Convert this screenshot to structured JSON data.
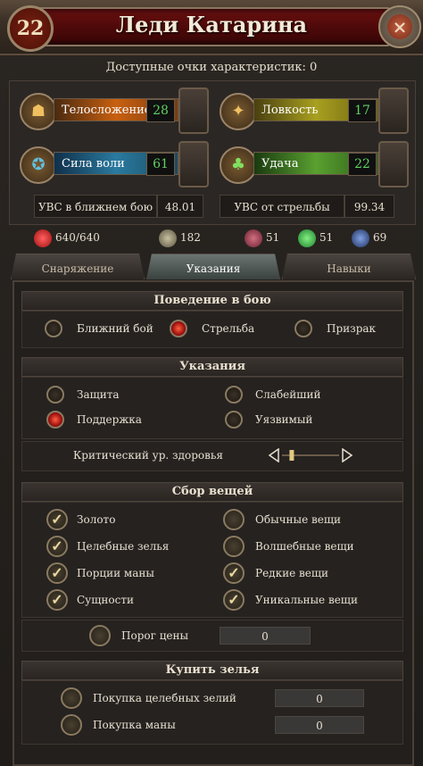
{
  "header": {
    "title": "Леди Катарина",
    "level": "22",
    "close_icon": "close-icon"
  },
  "points_label": "Доступные очки характеристик: 0",
  "attributes": [
    {
      "name": "Телосложение",
      "value": "28",
      "icon": "constitution-icon",
      "color": "#c86010"
    },
    {
      "name": "Ловкость",
      "value": "17",
      "icon": "dexterity-icon",
      "color": "#a8a020"
    },
    {
      "name": "Сила воли",
      "value": "61",
      "icon": "willpower-icon",
      "color": "#2a7aa0"
    },
    {
      "name": "Удача",
      "value": "22",
      "icon": "luck-icon",
      "color": "#5aa030"
    }
  ],
  "uvs": [
    {
      "label": "УВС в ближнем бою",
      "value": "48.01"
    },
    {
      "label": "УВС от стрельбы",
      "value": "99.34"
    }
  ],
  "resources": [
    {
      "icon": "health-orb-icon",
      "value": "640/640",
      "color": "#d02020"
    },
    {
      "icon": "armor-icon",
      "value": "182",
      "color": "#8a8a70"
    },
    {
      "icon": "fire-resist-icon",
      "value": "51",
      "color": "#a04050"
    },
    {
      "icon": "poison-resist-icon",
      "value": "51",
      "color": "#30a040"
    },
    {
      "icon": "magic-resist-icon",
      "value": "69",
      "color": "#4060a0"
    }
  ],
  "tabs": [
    {
      "label": "Снаряжение",
      "active": false
    },
    {
      "label": "Указания",
      "active": true
    },
    {
      "label": "Навыки",
      "active": false
    }
  ],
  "combat": {
    "title": "Поведение в бою",
    "options": [
      {
        "label": "Ближний бой",
        "selected": false
      },
      {
        "label": "Стрельба",
        "selected": true
      },
      {
        "label": "Призрак",
        "selected": false
      }
    ]
  },
  "orders": {
    "title": "Указания",
    "options": [
      {
        "label": "Защита",
        "selected": false
      },
      {
        "label": "Слабейший",
        "selected": false
      },
      {
        "label": "Поддержка",
        "selected": true
      },
      {
        "label": "Уязвимый",
        "selected": false
      }
    ],
    "critical_label": "Критический ур. здоровья",
    "critical_level": 0.1
  },
  "loot": {
    "title": "Сбор вещей",
    "items": [
      {
        "label": "Золото",
        "checked": true
      },
      {
        "label": "Обычные вещи",
        "checked": false
      },
      {
        "label": "Целебные зелья",
        "checked": true
      },
      {
        "label": "Волшебные вещи",
        "checked": false
      },
      {
        "label": "Порции маны",
        "checked": true
      },
      {
        "label": "Редкие вещи",
        "checked": true
      },
      {
        "label": "Сущности",
        "checked": true
      },
      {
        "label": "Уникальные вещи",
        "checked": true
      }
    ],
    "threshold_label": "Порог цены",
    "threshold_value": "0"
  },
  "potions": {
    "title": "Купить зелья",
    "items": [
      {
        "label": "Покупка целебных зелий",
        "value": "0"
      },
      {
        "label": "Покупка маны",
        "value": "0"
      }
    ]
  }
}
